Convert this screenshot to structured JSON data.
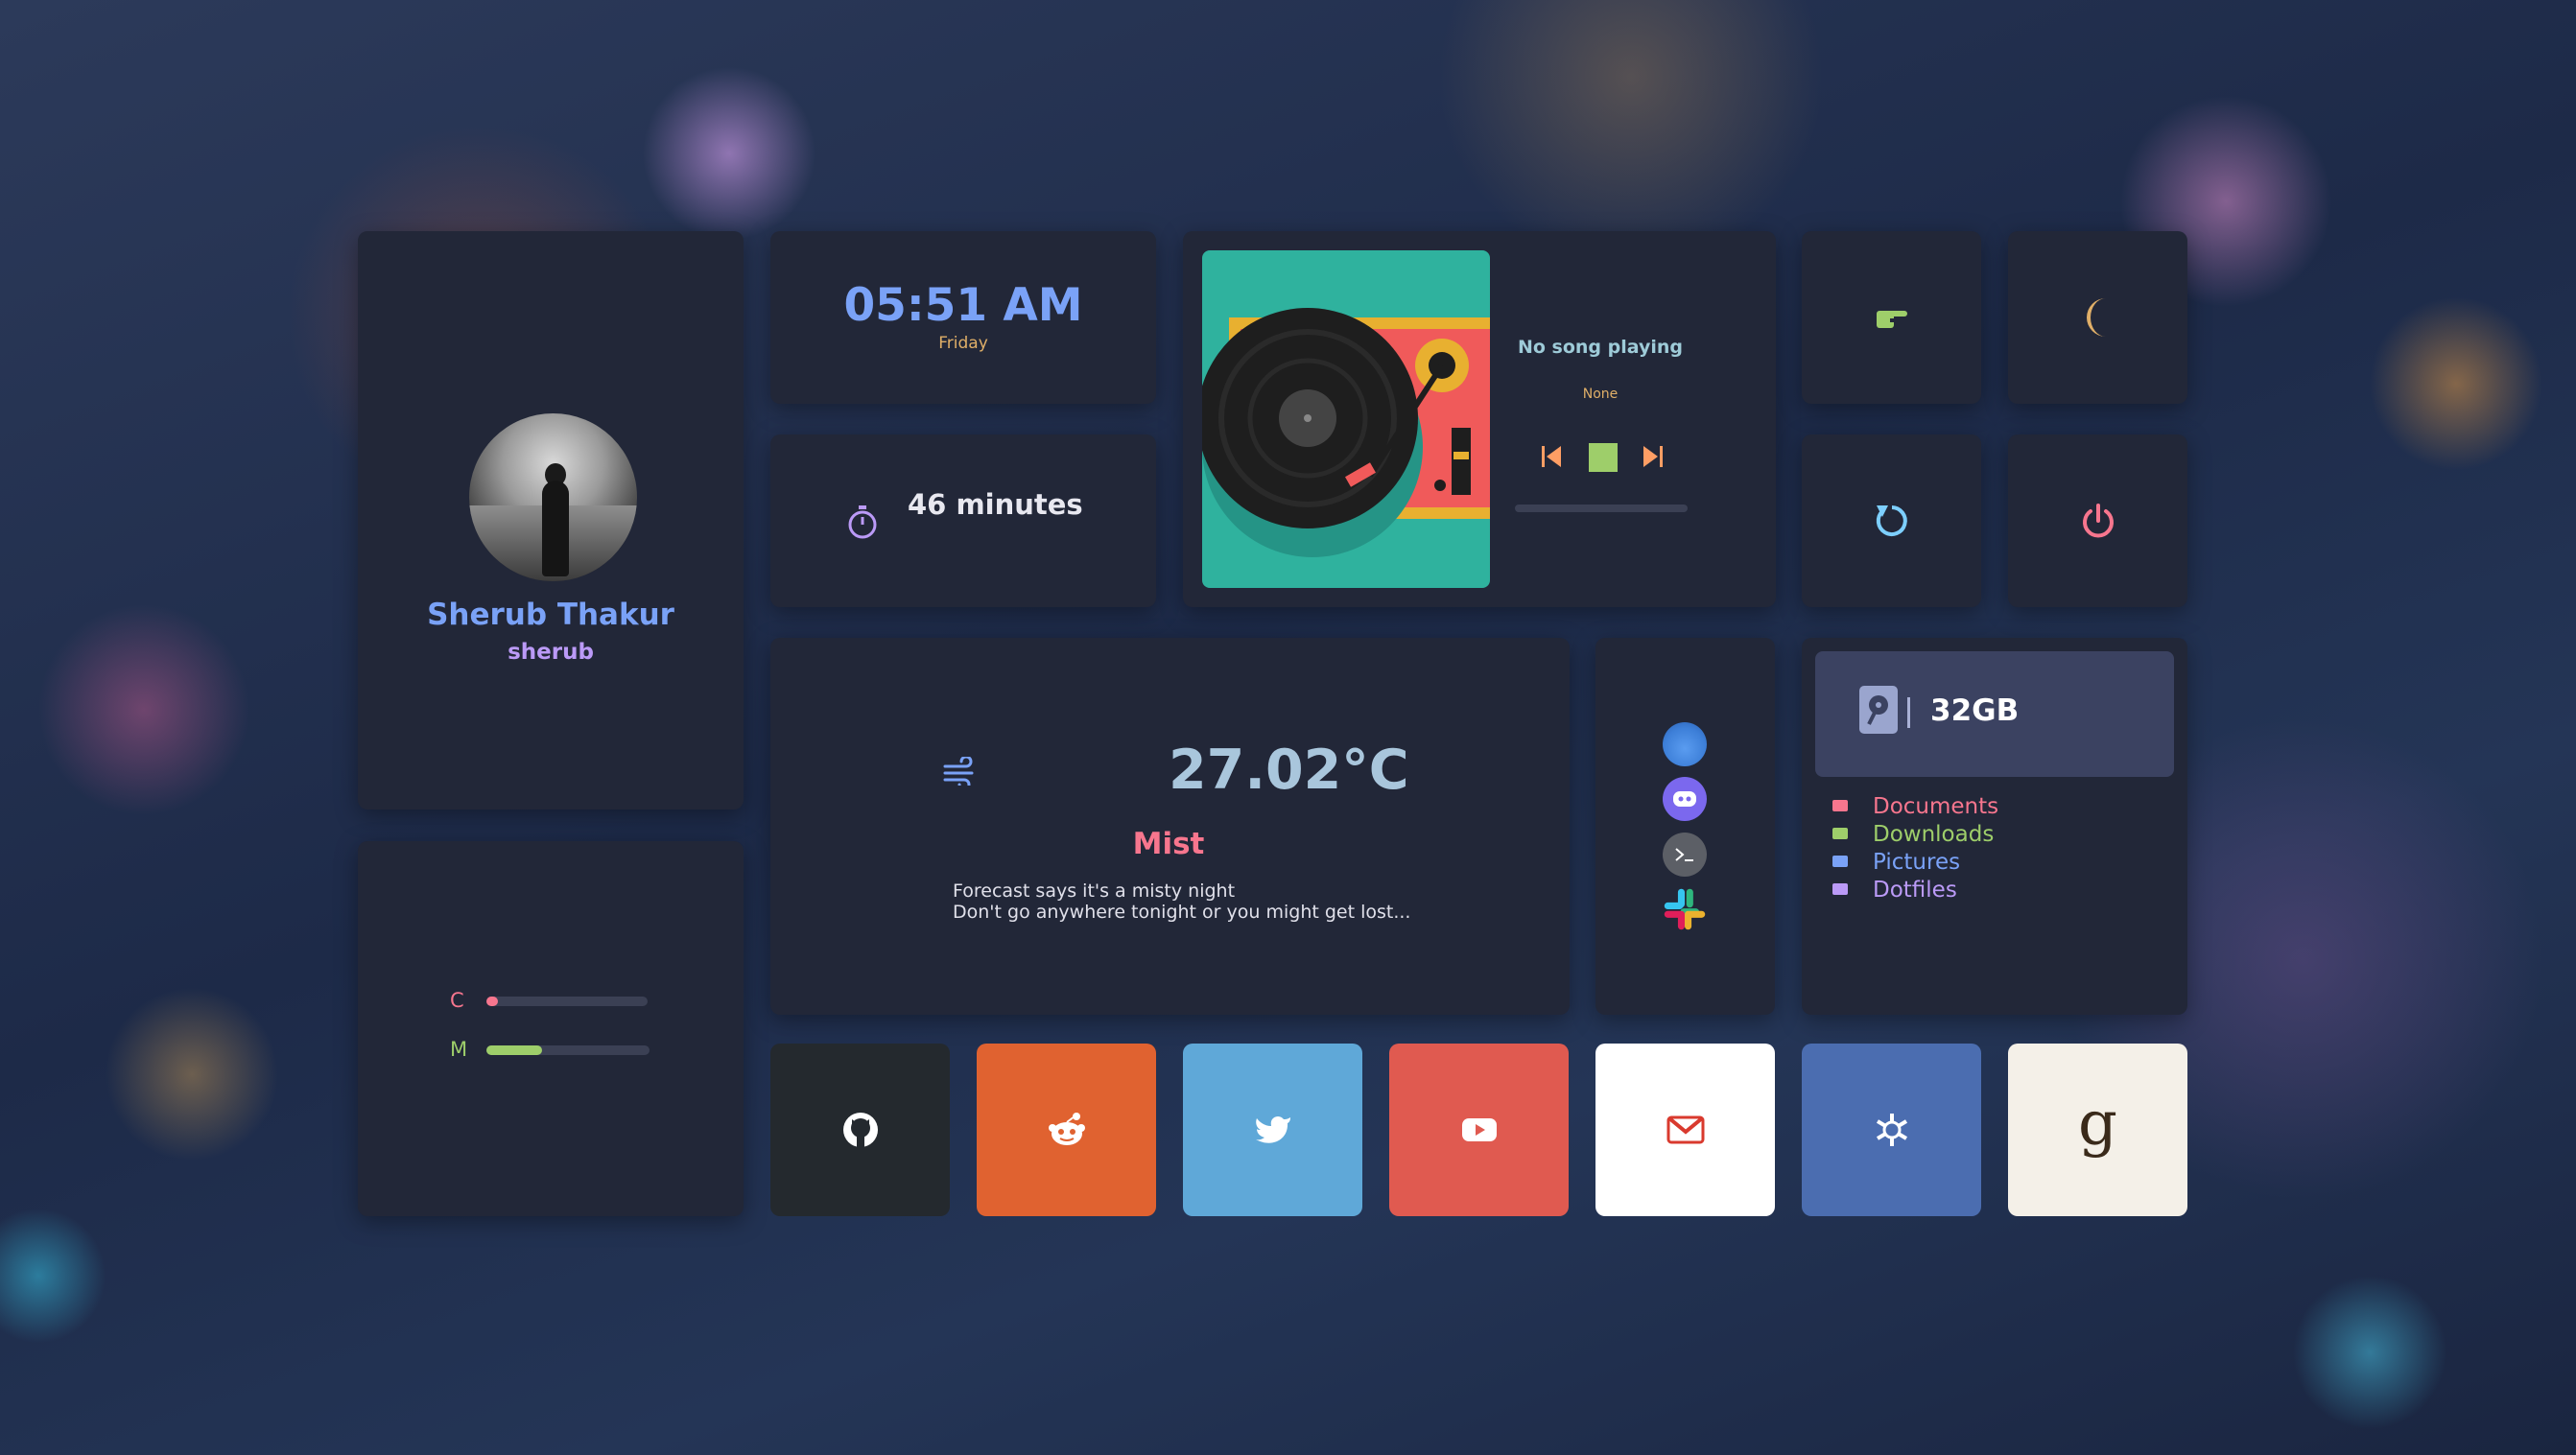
{
  "profile": {
    "name": "Sherub Thakur",
    "username": "sherub"
  },
  "clock": {
    "time": "05:51 AM",
    "day": "Friday"
  },
  "uptime": {
    "text": "46 minutes",
    "icon": "stopwatch-icon"
  },
  "music": {
    "title": "No song playing",
    "artist": "None",
    "progress": 0,
    "controls": [
      "previous",
      "stop",
      "next"
    ]
  },
  "power": {
    "buttons": [
      {
        "name": "lock",
        "icon": "pointing-hand-icon",
        "color": "#9ece6a"
      },
      {
        "name": "sleep",
        "icon": "moon-icon",
        "color": "#e0af68"
      },
      {
        "name": "restart",
        "icon": "restart-icon",
        "color": "#7dcfff"
      },
      {
        "name": "shutdown",
        "icon": "power-icon",
        "color": "#f7768e"
      }
    ]
  },
  "weather": {
    "temperature": "27.02°C",
    "condition": "Mist",
    "icon": "wind-icon",
    "description_line1": "Forecast says it's a misty night",
    "description_line2": "Don't go anywhere tonight or you might get lost..."
  },
  "apps": [
    "browser",
    "discord",
    "terminal",
    "slack"
  ],
  "files": {
    "disk": "32GB",
    "folders": [
      {
        "label": "Documents",
        "color": "#f7768e"
      },
      {
        "label": "Downloads",
        "color": "#9ece6a"
      },
      {
        "label": "Pictures",
        "color": "#7aa2f7"
      },
      {
        "label": "Dotfiles",
        "color": "#bb9af7"
      }
    ]
  },
  "stats": {
    "cpu": {
      "label": "C",
      "value": 0.05,
      "color": "#f7768e"
    },
    "memory": {
      "label": "M",
      "value": 0.34,
      "color": "#9ece6a"
    }
  },
  "bookmarks": [
    {
      "name": "github",
      "bg": "#24292e"
    },
    {
      "name": "reddit",
      "bg": "#e06230"
    },
    {
      "name": "twitter",
      "bg": "#5fa8d8"
    },
    {
      "name": "youtube",
      "bg": "#e05a50"
    },
    {
      "name": "gmail",
      "bg": "#ffffff"
    },
    {
      "name": "nixos",
      "bg": "#4b6db0"
    },
    {
      "name": "goodreads",
      "bg": "#f4f0e8",
      "glyph": "g"
    }
  ]
}
